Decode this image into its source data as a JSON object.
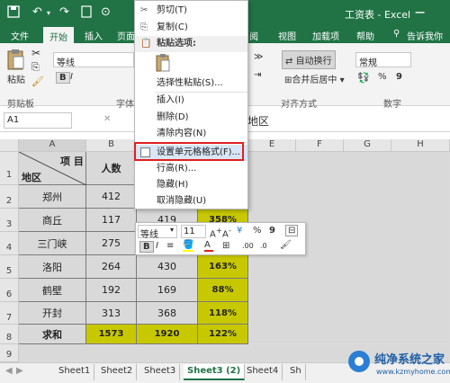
{
  "window": {
    "title": "工资表 - Excel"
  },
  "ribbon": {
    "tabs": [
      {
        "label": "文件"
      },
      {
        "label": "开始"
      },
      {
        "label": "插入"
      },
      {
        "label": "页面"
      },
      {
        "label": "阅"
      },
      {
        "label": "视图"
      },
      {
        "label": "加载项"
      },
      {
        "label": "帮助"
      },
      {
        "label": "告诉我你想"
      }
    ],
    "font_name": "等线",
    "wrap_text": "自动换行",
    "merge_center": "合并后居中",
    "number_format": "常规",
    "paste_label": "粘贴",
    "groups": {
      "clipboard": "剪贴板",
      "font": "字体",
      "alignment": "对齐方式",
      "number": "数字"
    },
    "bold": "B",
    "italic": "I",
    "percent": "%",
    "comma": "9"
  },
  "formula_bar": {
    "name_box": "A1",
    "content": "地区"
  },
  "columns": [
    "A",
    "B",
    "C",
    "D",
    "E",
    "F",
    "G",
    "H"
  ],
  "rows": [
    "1",
    "2",
    "3",
    "4",
    "5",
    "6",
    "7",
    "8",
    "9"
  ],
  "table": {
    "header_item": "项 目",
    "header_region": "地区",
    "header_people": "人数",
    "rows": [
      {
        "region": "郑州",
        "people": "412",
        "c": "",
        "d": ""
      },
      {
        "region": "商丘",
        "people": "117",
        "c": "419",
        "d": "358%"
      },
      {
        "region": "三门峡",
        "people": "275",
        "c": "",
        "d": ""
      },
      {
        "region": "洛阳",
        "people": "264",
        "c": "430",
        "d": "163%"
      },
      {
        "region": "鹤壁",
        "people": "192",
        "c": "169",
        "d": "88%"
      },
      {
        "region": "开封",
        "people": "313",
        "c": "368",
        "d": "118%"
      },
      {
        "region": "求和",
        "people": "1573",
        "c": "1920",
        "d": "122%"
      }
    ]
  },
  "context_menu": {
    "cut": "剪切(T)",
    "copy": "复制(C)",
    "paste_options": "粘贴选项:",
    "paste_special": "选择性粘贴(S)...",
    "insert": "插入(I)",
    "delete": "删除(D)",
    "clear": "清除内容(N)",
    "format_cells": "设置单元格格式(F)...",
    "row_height": "行高(R)...",
    "hide": "隐藏(H)",
    "unhide": "取消隐藏(U)"
  },
  "mini_toolbar": {
    "font": "等线",
    "size": "11",
    "bold": "B",
    "italic": "I",
    "percent": "%",
    "comma": "9"
  },
  "sheets": [
    {
      "label": "Sheet1"
    },
    {
      "label": "Sheet2"
    },
    {
      "label": "Sheet3"
    },
    {
      "label": "Sheet3 (2)"
    },
    {
      "label": "Sheet4"
    },
    {
      "label": "Sh"
    }
  ],
  "watermark": {
    "text": "纯净系统之家",
    "url": "www.kzmyhome.com"
  },
  "colors": {
    "excel_green": "#217346",
    "yellow_fill": "#c8c800",
    "highlight_red": "#e02020"
  }
}
